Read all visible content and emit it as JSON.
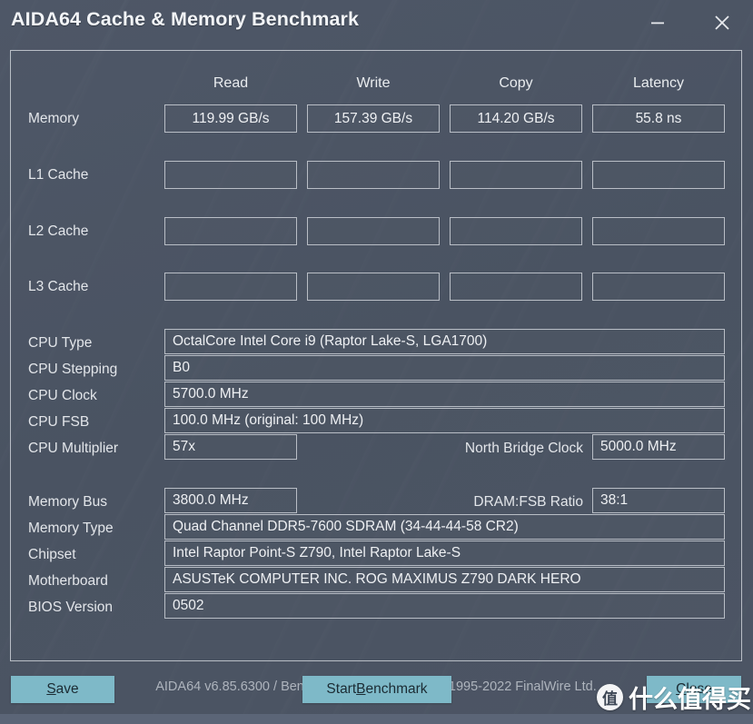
{
  "window": {
    "title": "AIDA64 Cache & Memory Benchmark",
    "minimize_icon": "minimize-icon",
    "close_icon": "close-icon"
  },
  "benchmark_table": {
    "columns": [
      "Read",
      "Write",
      "Copy",
      "Latency"
    ],
    "rows": [
      {
        "label": "Memory",
        "values": [
          "119.99 GB/s",
          "157.39 GB/s",
          "114.20 GB/s",
          "55.8 ns"
        ]
      },
      {
        "label": "L1 Cache",
        "values": [
          "",
          "",
          "",
          ""
        ]
      },
      {
        "label": "L2 Cache",
        "values": [
          "",
          "",
          "",
          ""
        ]
      },
      {
        "label": "L3 Cache",
        "values": [
          "",
          "",
          "",
          ""
        ]
      }
    ]
  },
  "cpu_info": {
    "cpu_type_label": "CPU Type",
    "cpu_type_value": "OctalCore Intel Core i9  (Raptor Lake-S, LGA1700)",
    "cpu_stepping_label": "CPU Stepping",
    "cpu_stepping_value": "B0",
    "cpu_clock_label": "CPU Clock",
    "cpu_clock_value": "5700.0 MHz",
    "cpu_fsb_label": "CPU FSB",
    "cpu_fsb_value": "100.0 MHz  (original: 100 MHz)",
    "cpu_multiplier_label": "CPU Multiplier",
    "cpu_multiplier_value": "57x",
    "north_bridge_clock_label": "North Bridge Clock",
    "north_bridge_clock_value": "5000.0 MHz"
  },
  "memory_info": {
    "memory_bus_label": "Memory Bus",
    "memory_bus_value": "3800.0 MHz",
    "dram_fsb_ratio_label": "DRAM:FSB Ratio",
    "dram_fsb_ratio_value": "38:1",
    "memory_type_label": "Memory Type",
    "memory_type_value": "Quad Channel DDR5-7600 SDRAM  (34-44-44-58 CR2)",
    "chipset_label": "Chipset",
    "chipset_value": "Intel Raptor Point-S Z790, Intel Raptor Lake-S",
    "motherboard_label": "Motherboard",
    "motherboard_value": "ASUSTeK COMPUTER INC. ROG MAXIMUS Z790 DARK HERO",
    "bios_version_label": "BIOS Version",
    "bios_version_value": "0502"
  },
  "credit": "AIDA64 v6.85.6300 / BenchDLL 4.6.875.8-x64  (c) 1995-2022 FinalWire Ltd.",
  "buttons": {
    "save": {
      "prefix": "",
      "accel": "S",
      "suffix": "ave"
    },
    "start_benchmark": {
      "prefix": "Start ",
      "accel": "B",
      "suffix": "enchmark"
    },
    "close": {
      "prefix": "",
      "accel": "C",
      "suffix": "lose"
    }
  },
  "watermark": {
    "logo_char": "值",
    "text": "什么值得买"
  },
  "colors": {
    "window_background": "#4b5564",
    "button_accent": "#7eb9c8",
    "border": "#b9bec6",
    "text": "#e8eaee",
    "credit_text": "#aeb4bd",
    "bottom_strip": "#5b6577"
  }
}
